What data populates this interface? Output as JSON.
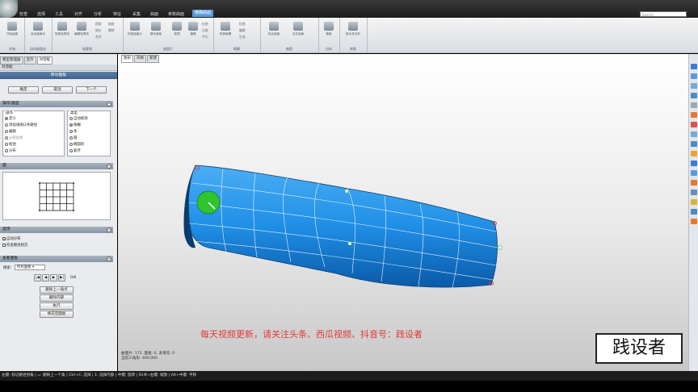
{
  "menu": [
    "检查",
    "选择",
    "工具",
    "对齐",
    "分析",
    "特征",
    "采集",
    "曲面",
    "参数曲面",
    "精确曲面"
  ],
  "menu_active_index": 9,
  "search": {
    "placeholder": "Search"
  },
  "ribbon": {
    "groups": [
      {
        "label": "开始",
        "buttons": [
          "开始曲面"
        ]
      },
      {
        "label": "自动曲面化",
        "buttons": [
          "自动曲面化"
        ]
      },
      {
        "label": "轮廓线",
        "buttons": [
          "探测轮廓线",
          "编辑轮廓线"
        ],
        "small": [
          "提取",
          "抽取",
          "细分",
          "合并",
          "删除"
        ]
      },
      {
        "label": "曲面片",
        "buttons": [
          "构造曲面片",
          "移动面板",
          "修理",
          "编辑"
        ],
        "small": [
          "松弛",
          "压缩",
          "平均"
        ]
      },
      {
        "label": "格栅",
        "buttons": [
          "构造格栅"
        ],
        "small": [
          "松弛",
          "编辑",
          "生成"
        ]
      },
      {
        "label": "曲面",
        "buttons": [
          "拟合曲面",
          "合并曲面"
        ]
      },
      {
        "label": "分析",
        "buttons": [
          "偏差"
        ]
      },
      {
        "label": "转换",
        "buttons": [
          "转为多边形"
        ]
      }
    ]
  },
  "panel": {
    "tabs": [
      "模型管理器",
      "显示",
      "对话框"
    ],
    "title": "对话框",
    "dialog_name": "移动面板",
    "ok": "确定",
    "cancel": "取消",
    "next": "下一个",
    "section_ops": "操作/类型",
    "ops_title": "操作",
    "ops": [
      "定义",
      "添加/删除2条路径",
      "编辑",
      "分裂面板",
      "松弛",
      "分布"
    ],
    "ops_selected": 0,
    "ops_disabled": [
      3
    ],
    "type_title": "类型",
    "types": [
      "自动探测",
      "格栅",
      "条",
      "圆",
      "椭圆的",
      "套环"
    ],
    "type_selected": 1,
    "section_face": "面",
    "section_options": "选项",
    "opt_auto": "自动分布",
    "opt_check": "检查路径相交",
    "section_view": "查看面板",
    "show_label": "搜索:",
    "show_value": "所有面板",
    "page_counter": "0/6",
    "actions": [
      "删除上一角点",
      "删除内部",
      "执行",
      "填充空面板"
    ]
  },
  "viewport": {
    "tabs": [
      "图形",
      "开始",
      "新建"
    ],
    "stats_1": "曲面片: 172, 面板: 6, 未填充: 0",
    "stats_2": "当前三角形: 400,000",
    "watermark": "每天视频更新，请关注头条、西瓜视频、抖音号：践设者",
    "brand": "践设者"
  },
  "status": "左键: 标记路径拐角 | =: 删除上一个角 | Ctrl+C: 选择 | 1: 选择内部 | 中键: 旋转 | Shift+右键: 缩放 | Alt+中键: 平移",
  "colors": {
    "model": "#1f8fe6",
    "grid": "#ffffff",
    "accent": "#5a9bd8",
    "watermark": "#e23838"
  }
}
